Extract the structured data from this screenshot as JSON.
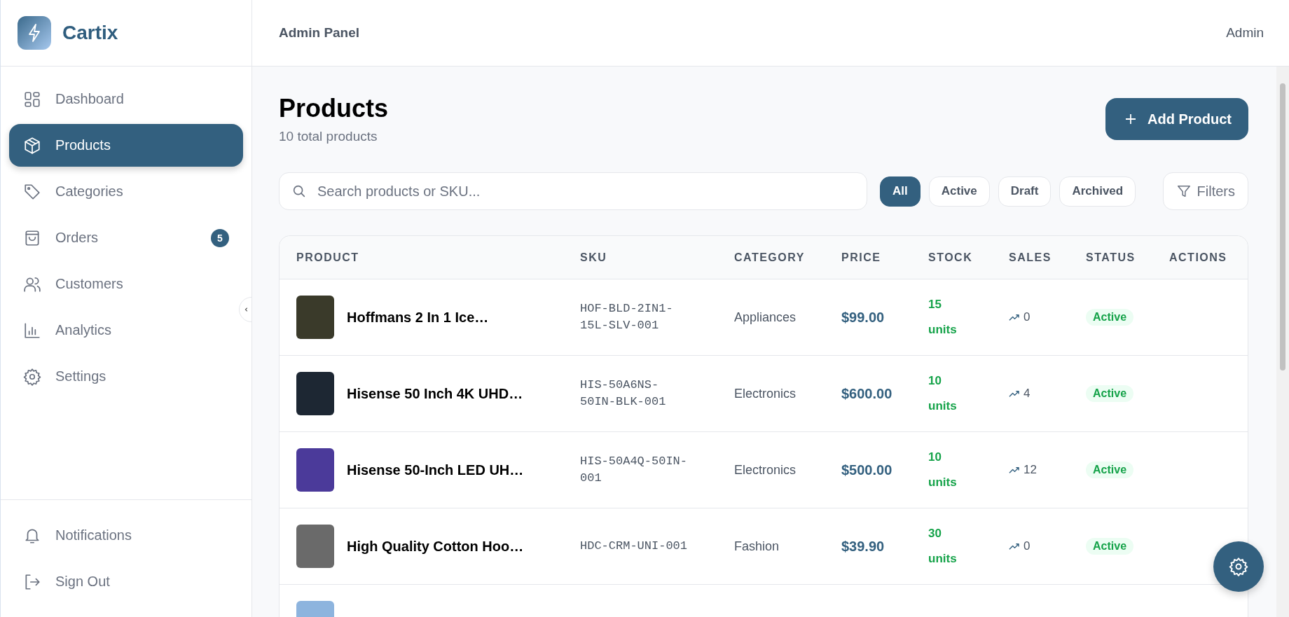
{
  "brand": {
    "name": "Cartix"
  },
  "sidebar": {
    "items": [
      {
        "label": "Dashboard",
        "selected": false
      },
      {
        "label": "Products",
        "selected": true
      },
      {
        "label": "Categories",
        "selected": false
      },
      {
        "label": "Orders",
        "selected": false,
        "badge": "5"
      },
      {
        "label": "Customers",
        "selected": false
      },
      {
        "label": "Analytics",
        "selected": false
      },
      {
        "label": "Settings",
        "selected": false
      }
    ],
    "footer_items": [
      {
        "label": "Notifications"
      },
      {
        "label": "Sign Out"
      }
    ]
  },
  "header": {
    "title": "Admin Panel",
    "user": "Admin"
  },
  "page": {
    "title": "Products",
    "subtitle": "10 total products",
    "add_button": "Add Product"
  },
  "search": {
    "placeholder": "Search products or SKU..."
  },
  "status_filters": [
    {
      "label": "All",
      "selected": true
    },
    {
      "label": "Active",
      "selected": false
    },
    {
      "label": "Draft",
      "selected": false
    },
    {
      "label": "Archived",
      "selected": false
    }
  ],
  "filters_button": "Filters",
  "table": {
    "columns": [
      "PRODUCT",
      "SKU",
      "CATEGORY",
      "PRICE",
      "STOCK",
      "SALES",
      "STATUS",
      "ACTIONS"
    ],
    "rows": [
      {
        "name": "Hoffmans 2 In 1 Ice…",
        "sku": "HOF-BLD-2IN1-15L-SLV-001",
        "category": "Appliances",
        "price": "$99.00",
        "stock": "15 units",
        "sales": "0",
        "status": "Active"
      },
      {
        "name": "Hisense 50 Inch 4K UHD…",
        "sku": "HIS-50A6NS-50IN-BLK-001",
        "category": "Electronics",
        "price": "$600.00",
        "stock": "10 units",
        "sales": "4",
        "status": "Active"
      },
      {
        "name": "Hisense 50-Inch LED UH…",
        "sku": "HIS-50A4Q-50IN-001",
        "category": "Electronics",
        "price": "$500.00",
        "stock": "10 units",
        "sales": "12",
        "status": "Active"
      },
      {
        "name": "High Quality Cotton Hoo…",
        "sku": "HDC-CRM-UNI-001",
        "category": "Fashion",
        "price": "$39.90",
        "stock": "30 units",
        "sales": "0",
        "status": "Active"
      },
      {}
    ]
  }
}
